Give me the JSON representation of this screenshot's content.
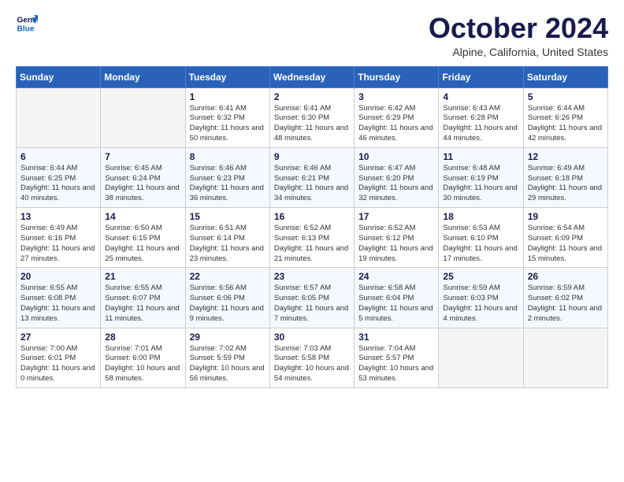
{
  "header": {
    "logo_line1": "General",
    "logo_line2": "Blue",
    "month_title": "October 2024",
    "location": "Alpine, California, United States"
  },
  "days_of_week": [
    "Sunday",
    "Monday",
    "Tuesday",
    "Wednesday",
    "Thursday",
    "Friday",
    "Saturday"
  ],
  "weeks": [
    [
      {
        "day": "",
        "info": ""
      },
      {
        "day": "",
        "info": ""
      },
      {
        "day": "1",
        "info": "Sunrise: 6:41 AM\nSunset: 6:32 PM\nDaylight: 11 hours and 50 minutes."
      },
      {
        "day": "2",
        "info": "Sunrise: 6:41 AM\nSunset: 6:30 PM\nDaylight: 11 hours and 48 minutes."
      },
      {
        "day": "3",
        "info": "Sunrise: 6:42 AM\nSunset: 6:29 PM\nDaylight: 11 hours and 46 minutes."
      },
      {
        "day": "4",
        "info": "Sunrise: 6:43 AM\nSunset: 6:28 PM\nDaylight: 11 hours and 44 minutes."
      },
      {
        "day": "5",
        "info": "Sunrise: 6:44 AM\nSunset: 6:26 PM\nDaylight: 11 hours and 42 minutes."
      }
    ],
    [
      {
        "day": "6",
        "info": "Sunrise: 6:44 AM\nSunset: 6:25 PM\nDaylight: 11 hours and 40 minutes."
      },
      {
        "day": "7",
        "info": "Sunrise: 6:45 AM\nSunset: 6:24 PM\nDaylight: 11 hours and 38 minutes."
      },
      {
        "day": "8",
        "info": "Sunrise: 6:46 AM\nSunset: 6:23 PM\nDaylight: 11 hours and 36 minutes."
      },
      {
        "day": "9",
        "info": "Sunrise: 6:46 AM\nSunset: 6:21 PM\nDaylight: 11 hours and 34 minutes."
      },
      {
        "day": "10",
        "info": "Sunrise: 6:47 AM\nSunset: 6:20 PM\nDaylight: 11 hours and 32 minutes."
      },
      {
        "day": "11",
        "info": "Sunrise: 6:48 AM\nSunset: 6:19 PM\nDaylight: 11 hours and 30 minutes."
      },
      {
        "day": "12",
        "info": "Sunrise: 6:49 AM\nSunset: 6:18 PM\nDaylight: 11 hours and 29 minutes."
      }
    ],
    [
      {
        "day": "13",
        "info": "Sunrise: 6:49 AM\nSunset: 6:16 PM\nDaylight: 11 hours and 27 minutes."
      },
      {
        "day": "14",
        "info": "Sunrise: 6:50 AM\nSunset: 6:15 PM\nDaylight: 11 hours and 25 minutes."
      },
      {
        "day": "15",
        "info": "Sunrise: 6:51 AM\nSunset: 6:14 PM\nDaylight: 11 hours and 23 minutes."
      },
      {
        "day": "16",
        "info": "Sunrise: 6:52 AM\nSunset: 6:13 PM\nDaylight: 11 hours and 21 minutes."
      },
      {
        "day": "17",
        "info": "Sunrise: 6:52 AM\nSunset: 6:12 PM\nDaylight: 11 hours and 19 minutes."
      },
      {
        "day": "18",
        "info": "Sunrise: 6:53 AM\nSunset: 6:10 PM\nDaylight: 11 hours and 17 minutes."
      },
      {
        "day": "19",
        "info": "Sunrise: 6:54 AM\nSunset: 6:09 PM\nDaylight: 11 hours and 15 minutes."
      }
    ],
    [
      {
        "day": "20",
        "info": "Sunrise: 6:55 AM\nSunset: 6:08 PM\nDaylight: 11 hours and 13 minutes."
      },
      {
        "day": "21",
        "info": "Sunrise: 6:55 AM\nSunset: 6:07 PM\nDaylight: 11 hours and 11 minutes."
      },
      {
        "day": "22",
        "info": "Sunrise: 6:56 AM\nSunset: 6:06 PM\nDaylight: 11 hours and 9 minutes."
      },
      {
        "day": "23",
        "info": "Sunrise: 6:57 AM\nSunset: 6:05 PM\nDaylight: 11 hours and 7 minutes."
      },
      {
        "day": "24",
        "info": "Sunrise: 6:58 AM\nSunset: 6:04 PM\nDaylight: 11 hours and 5 minutes."
      },
      {
        "day": "25",
        "info": "Sunrise: 6:59 AM\nSunset: 6:03 PM\nDaylight: 11 hours and 4 minutes."
      },
      {
        "day": "26",
        "info": "Sunrise: 6:59 AM\nSunset: 6:02 PM\nDaylight: 11 hours and 2 minutes."
      }
    ],
    [
      {
        "day": "27",
        "info": "Sunrise: 7:00 AM\nSunset: 6:01 PM\nDaylight: 11 hours and 0 minutes."
      },
      {
        "day": "28",
        "info": "Sunrise: 7:01 AM\nSunset: 6:00 PM\nDaylight: 10 hours and 58 minutes."
      },
      {
        "day": "29",
        "info": "Sunrise: 7:02 AM\nSunset: 5:59 PM\nDaylight: 10 hours and 56 minutes."
      },
      {
        "day": "30",
        "info": "Sunrise: 7:03 AM\nSunset: 5:58 PM\nDaylight: 10 hours and 54 minutes."
      },
      {
        "day": "31",
        "info": "Sunrise: 7:04 AM\nSunset: 5:57 PM\nDaylight: 10 hours and 53 minutes."
      },
      {
        "day": "",
        "info": ""
      },
      {
        "day": "",
        "info": ""
      }
    ]
  ]
}
